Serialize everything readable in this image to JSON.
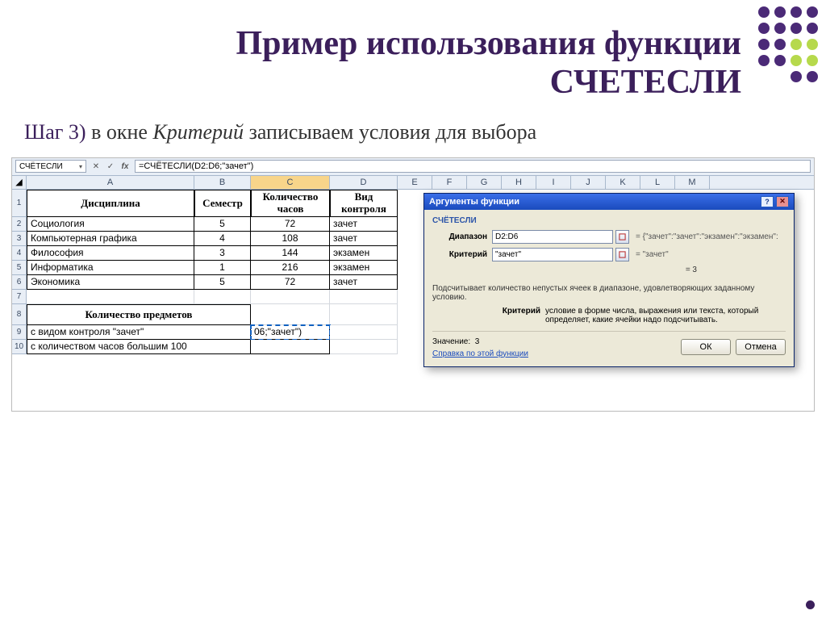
{
  "title_line1": "Пример использования функции",
  "title_line2": "СЧЕТЕСЛИ",
  "step_label": "Шаг 3)",
  "step_text_1": " в окне ",
  "step_emph": "Критерий",
  "step_text_2": " записываем условия для выбора",
  "formula_bar": {
    "name_box": "СЧЁТЕСЛИ",
    "formula": "=СЧЁТЕСЛИ(D2:D6;\"зачет\")"
  },
  "columns": [
    "A",
    "B",
    "C",
    "D",
    "E",
    "F",
    "G",
    "H",
    "I",
    "J",
    "K",
    "L",
    "M"
  ],
  "table": {
    "header": {
      "A": "Дисциплина",
      "B": "Семестр",
      "C": "Количество часов",
      "D": "Вид контроля"
    },
    "rows": [
      {
        "A": "Социология",
        "B": "5",
        "C": "72",
        "D": "зачет"
      },
      {
        "A": "Компьютерная графика",
        "B": "4",
        "C": "108",
        "D": "зачет"
      },
      {
        "A": "Философия",
        "B": "3",
        "C": "144",
        "D": "экзамен"
      },
      {
        "A": "Информатика",
        "B": "1",
        "C": "216",
        "D": "экзамен"
      },
      {
        "A": "Экономика",
        "B": "5",
        "C": "72",
        "D": "зачет"
      }
    ],
    "section_title": "Количество предметов",
    "q1_label": "с видом контроля \"зачет\"",
    "q1_value": "06;\"зачет\")",
    "q2_label": "с количеством часов большим 100"
  },
  "dialog": {
    "title": "Аргументы функции",
    "func": "СЧЁТЕСЛИ",
    "f_range_label": "Диапазон",
    "f_range_value": "D2:D6",
    "f_range_eq": "= {\"зачет\":\"зачет\":\"экзамен\":\"экзамен\":",
    "f_crit_label": "Критерий",
    "f_crit_value": "\"зачет\"",
    "f_crit_eq": "= \"зачет\"",
    "result_eq": "= 3",
    "desc": "Подсчитывает количество непустых ячеек в диапазоне, удовлетворяющих заданному условию.",
    "param_name": "Критерий",
    "param_desc": "условие в форме числа, выражения или текста, который определяет, какие ячейки надо подсчитывать.",
    "value_label": "Значение:",
    "value_num": "3",
    "help_link": "Справка по этой функции",
    "ok": "ОК",
    "cancel": "Отмена"
  }
}
